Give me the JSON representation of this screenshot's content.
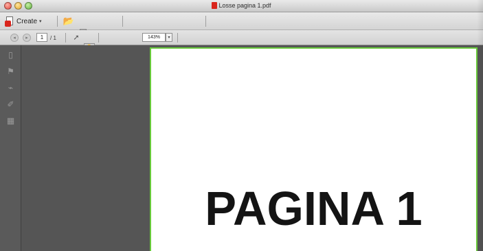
{
  "window": {
    "title": "Losse pagina 1.pdf"
  },
  "toolbar1": {
    "create_label": "Create",
    "create_caret": "▾",
    "tools": [
      {
        "name": "open-icon",
        "glyph": "📂"
      },
      {
        "name": "save-icon",
        "glyph": "▤"
      },
      {
        "name": "print-icon",
        "glyph": "⎙"
      },
      {
        "name": "email-icon",
        "glyph": "✉"
      },
      {
        "name": "settings-icon",
        "glyph": "⚙"
      },
      {
        "name": "comment-icon",
        "glyph": "◌"
      },
      {
        "name": "stamp-icon",
        "glyph": "◈"
      },
      {
        "name": "attach-icon",
        "glyph": "⎘"
      },
      {
        "name": "export-icon",
        "glyph": "⎗"
      },
      {
        "name": "combine-icon",
        "glyph": "⎙"
      },
      {
        "name": "form-icon",
        "glyph": "▣"
      },
      {
        "name": "sign-icon",
        "glyph": "✎"
      },
      {
        "name": "measure-icon",
        "glyph": "⌐"
      },
      {
        "name": "edit-icon",
        "glyph": "▥"
      }
    ]
  },
  "toolbar2": {
    "prev_glyph": "◂",
    "next_glyph": "▸",
    "page_current": "1",
    "page_total": "/ 1",
    "zoom_value": "143%",
    "zoom_caret": "▾"
  },
  "document": {
    "heading": "PAGINA 1"
  },
  "colors": {
    "rail_bg": "#5a5a5a",
    "pane_bg": "#555555",
    "page_border": "#68c93a",
    "title_badge": "#d9251c"
  }
}
